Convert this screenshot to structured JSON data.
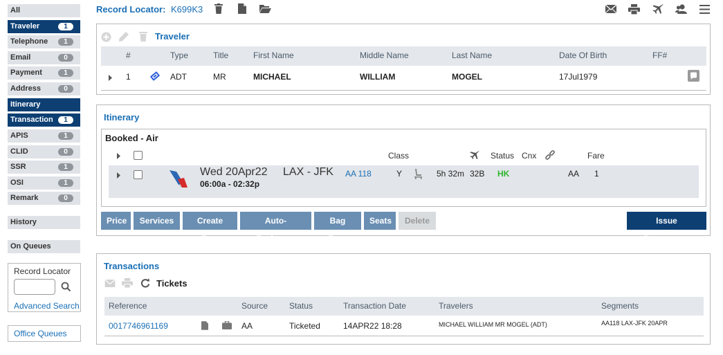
{
  "sidebar": {
    "items": [
      {
        "label": "All",
        "badge": null,
        "active": false
      },
      {
        "label": "Traveler",
        "badge": "1",
        "active": true
      },
      {
        "label": "Telephone",
        "badge": "1",
        "active": false
      },
      {
        "label": "Email",
        "badge": "0",
        "active": false
      },
      {
        "label": "Payment",
        "badge": "1",
        "active": false
      },
      {
        "label": "Address",
        "badge": "0",
        "active": false
      },
      {
        "label": "Itinerary",
        "badge": null,
        "active": true
      },
      {
        "label": "Transaction",
        "badge": "1",
        "active": true
      },
      {
        "label": "APIS",
        "badge": "1",
        "active": false
      },
      {
        "label": "CLID",
        "badge": "0",
        "active": false
      },
      {
        "label": "SSR",
        "badge": "1",
        "active": false
      },
      {
        "label": "OSI",
        "badge": "1",
        "active": false
      },
      {
        "label": "Remark",
        "badge": "0",
        "active": false
      }
    ],
    "history": "History",
    "on_queues": "On Queues",
    "record_locator_label": "Record Locator",
    "record_locator_value": "",
    "advanced_search": "Advanced Search",
    "office_queues": "Office Queues"
  },
  "header": {
    "record_locator_label": "Record Locator:",
    "record_locator_value": "K699K3"
  },
  "traveler": {
    "title": "Traveler",
    "columns": [
      "#",
      "Type",
      "Title",
      "First Name",
      "Middle Name",
      "Last Name",
      "Date Of Birth",
      "FF#"
    ],
    "row": {
      "num": "1",
      "type": "ADT",
      "title": "MR",
      "first": "MICHAEL",
      "middle": "WILLIAM",
      "last": "MOGEL",
      "dob": "17Jul1979",
      "ff": ""
    }
  },
  "itinerary": {
    "title": "Itinerary",
    "section": "Booked - Air",
    "columns": {
      "class": "Class",
      "status": "Status",
      "cnx": "Cnx",
      "fare": "Fare"
    },
    "segment": {
      "date": "Wed 20Apr22",
      "times": "06:00a - 02:32p",
      "route": "LAX - JFK",
      "flight": "AA 118",
      "class": "Y",
      "duration": "5h 32m",
      "seat": "32B",
      "status": "HK",
      "fare_carrier": "AA",
      "fare_num": "1"
    },
    "buttons": [
      "Price",
      "Services",
      "Create Fare",
      "Auto-Exchange",
      "Bag Fees",
      "Seats",
      "Delete"
    ],
    "issue": "Issue Documents"
  },
  "transactions": {
    "title": "Transactions",
    "subtitle": "Tickets",
    "columns": [
      "Reference",
      "Source",
      "Status",
      "Transaction Date",
      "Travelers",
      "Segments"
    ],
    "row": {
      "reference": "0017746961169",
      "source": "AA",
      "status": "Ticketed",
      "date": "14APR22 18:28",
      "travelers": "MICHAEL WILLIAM MR MOGEL (ADT)",
      "segments": "AA118 LAX-JFK 20APR"
    }
  },
  "colors": {
    "accent": "#1a6fb5",
    "nav_active": "#0d3f73",
    "button": "#6a8fb3",
    "status_ok": "#2fb52f"
  }
}
